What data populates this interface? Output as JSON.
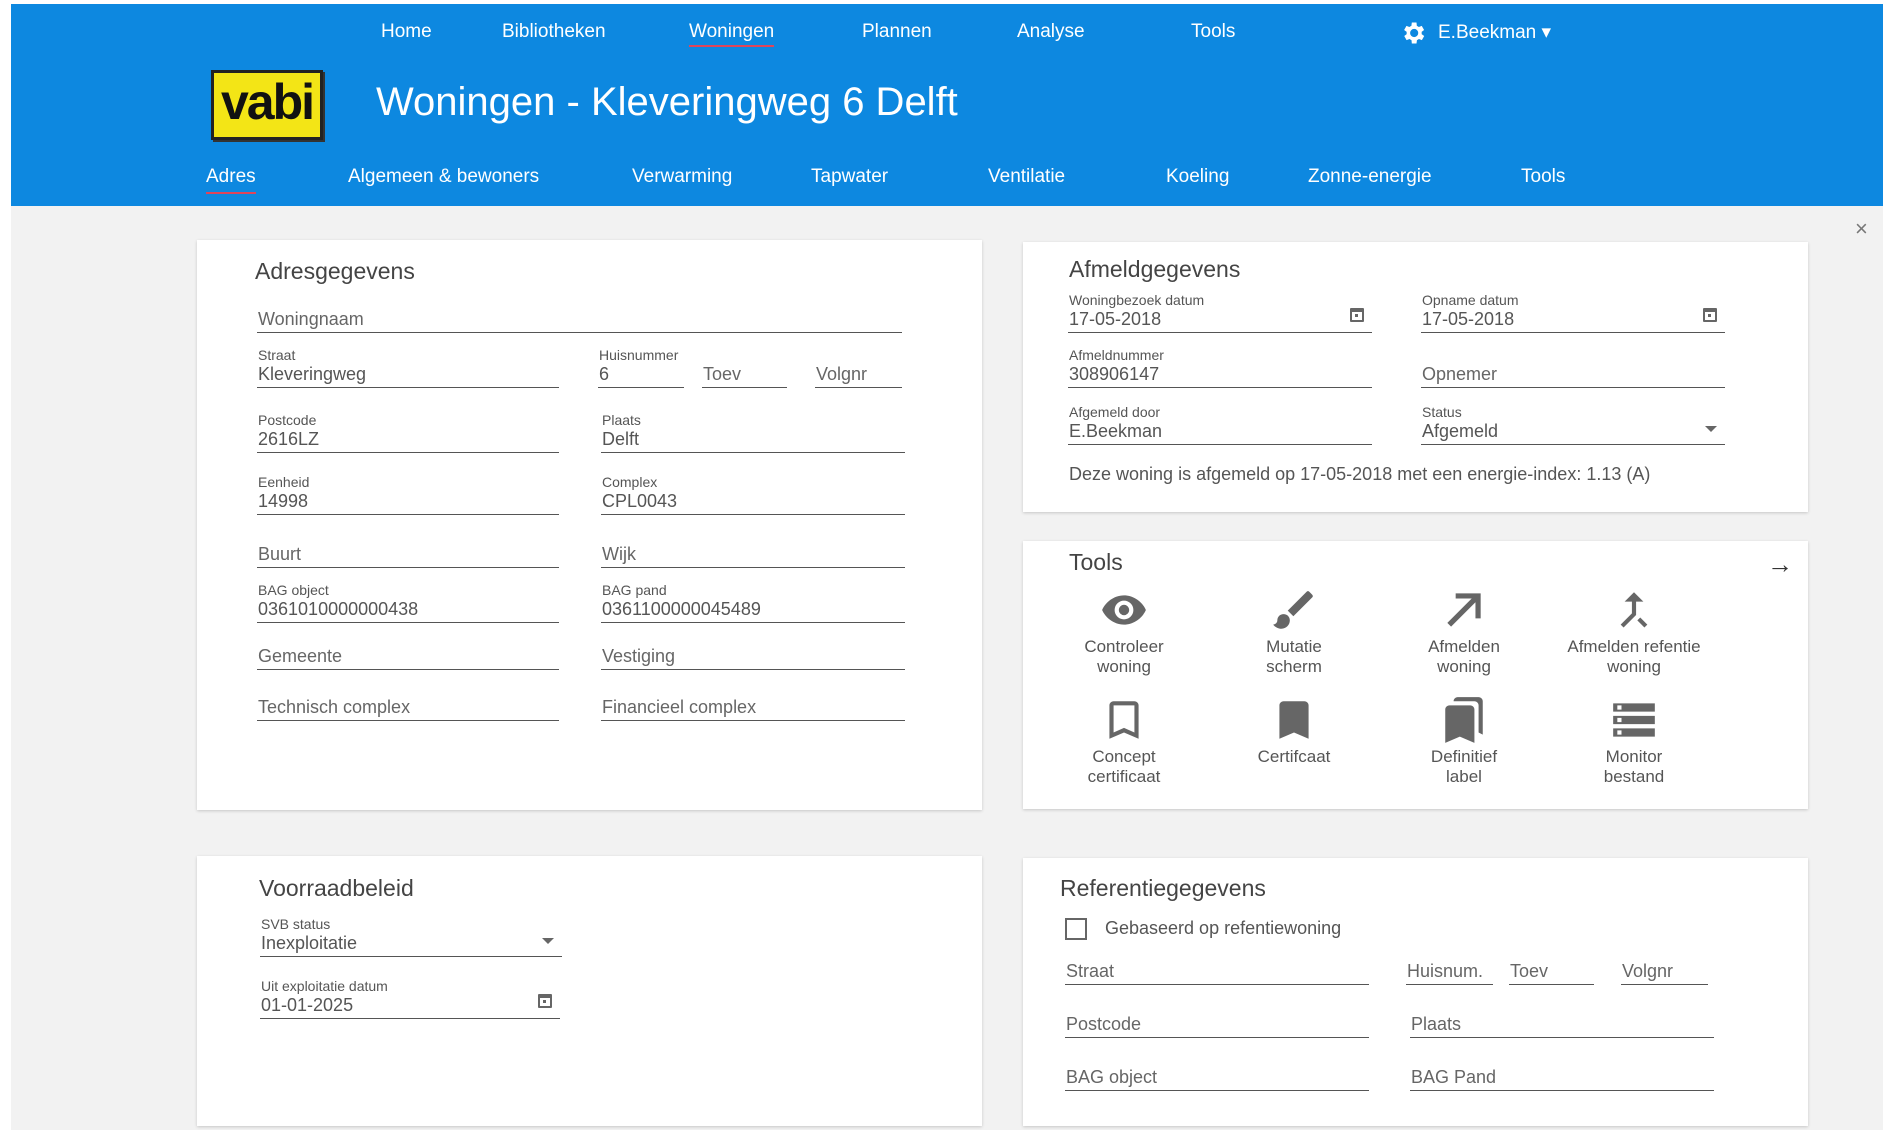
{
  "topnav": {
    "home": "Home",
    "bibliotheken": "Bibliotheken",
    "woningen": "Woningen",
    "plannen": "Plannen",
    "analyse": "Analyse",
    "tools": "Tools",
    "user": "E.Beekman ▾"
  },
  "logo": "vabi",
  "page_title": "Woningen - Kleveringweg 6 Delft",
  "subnav": {
    "adres": "Adres",
    "algemeen": "Algemeen & bewoners",
    "verwarming": "Verwarming",
    "tapwater": "Tapwater",
    "ventilatie": "Ventilatie",
    "koeling": "Koeling",
    "zonne": "Zonne-energie",
    "tools": "Tools"
  },
  "close": "×",
  "adres": {
    "title": "Adresgegevens",
    "woningnaam": "Woningnaam",
    "straat_label": "Straat",
    "straat": "Kleveringweg",
    "huisnummer_label": "Huisnummer",
    "huisnummer": "6",
    "toev": "Toev",
    "volgnr": "Volgnr",
    "postcode_label": "Postcode",
    "postcode": "2616LZ",
    "plaats_label": "Plaats",
    "plaats": "Delft",
    "eenheid_label": "Eenheid",
    "eenheid": "14998",
    "complex_label": "Complex",
    "complex": "CPL0043",
    "buurt": "Buurt",
    "wijk": "Wijk",
    "bag_object_label": "BAG object",
    "bag_object": "0361010000000438",
    "bag_pand_label": "BAG pand",
    "bag_pand": "0361100000045489",
    "gemeente": "Gemeente",
    "vestiging": "Vestiging",
    "technisch_complex": "Technisch complex",
    "financieel_complex": "Financieel complex"
  },
  "afmeld": {
    "title": "Afmeldgegevens",
    "woningbezoek_label": "Woningbezoek datum",
    "woningbezoek": "17-05-2018",
    "opname_label": "Opname datum",
    "opname": "17-05-2018",
    "afmeldnummer_label": "Afmeldnummer",
    "afmeldnummer": "308906147",
    "opnemer": "Opnemer",
    "afgemeld_door_label": "Afgemeld door",
    "afgemeld_door": "E.Beekman",
    "status_label": "Status",
    "status": "Afgemeld",
    "note": "Deze woning is afgemeld op 17-05-2018 met een energie-index: 1.13 (A)"
  },
  "tools": {
    "title": "Tools",
    "arrow": "→",
    "items": [
      {
        "l1": "Controleer",
        "l2": "woning",
        "icon": "eye-icon"
      },
      {
        "l1": "Mutatie",
        "l2": "scherm",
        "icon": "brush-icon"
      },
      {
        "l1": "Afmelden",
        "l2": "woning",
        "icon": "arrow-up-right-icon"
      },
      {
        "l1": "Afmelden refentie",
        "l2": "woning",
        "icon": "merge-icon"
      },
      {
        "l1": "Concept",
        "l2": "certificaat",
        "icon": "bookmark-outline-icon"
      },
      {
        "l1": "Certifcaat",
        "l2": "",
        "icon": "bookmark-icon"
      },
      {
        "l1": "Definitief",
        "l2": "label",
        "icon": "bookmarks-icon"
      },
      {
        "l1": "Monitor",
        "l2": "bestand",
        "icon": "storage-icon"
      }
    ]
  },
  "voorraad": {
    "title": "Voorraadbeleid",
    "svb_label": "SVB status",
    "svb": "Inexploitatie",
    "uit_label": "Uit exploitatie datum",
    "uit": "01-01-2025"
  },
  "referentie": {
    "title": "Referentiegegevens",
    "checkbox_label": "Gebaseerd op refentiewoning",
    "straat": "Straat",
    "huisnum": "Huisnum.",
    "toev": "Toev",
    "volgnr": "Volgnr",
    "postcode": "Postcode",
    "plaats": "Plaats",
    "bag_object": "BAG object",
    "bag_pand": "BAG Pand"
  }
}
